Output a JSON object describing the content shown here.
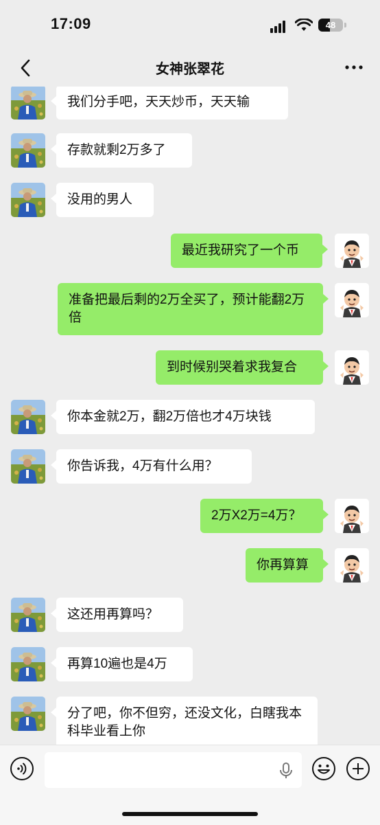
{
  "status": {
    "time": "17:09",
    "battery": "48",
    "battery_level": 0.48
  },
  "header": {
    "title": "女神张翠花"
  },
  "icons": {
    "back": "chevron-left-icon",
    "more": "ellipsis-icon",
    "voice": "voice-icon",
    "mic": "mic-icon",
    "emoji": "emoji-icon",
    "plus": "plus-icon"
  },
  "colors": {
    "background": "#ededed",
    "bubble_sent": "#95ec69",
    "bubble_received": "#ffffff"
  },
  "messages": [
    {
      "side": "left",
      "text": "我们分手吧，天天炒币，天天输"
    },
    {
      "side": "left",
      "text": "存款就剩2万多了"
    },
    {
      "side": "left",
      "text": "没用的男人"
    },
    {
      "side": "right",
      "text": "最近我研究了一个币"
    },
    {
      "side": "right",
      "text": "准备把最后剩的2万全买了，预计能翻2万倍"
    },
    {
      "side": "right",
      "text": "到时候别哭着求我复合"
    },
    {
      "side": "left",
      "text": "你本金就2万，翻2万倍也才4万块钱"
    },
    {
      "side": "left",
      "text": "你告诉我，4万有什么用？"
    },
    {
      "side": "right",
      "text": "2万X2万=4万？"
    },
    {
      "side": "right",
      "text": "你再算算"
    },
    {
      "side": "left",
      "text": "这还用再算吗？"
    },
    {
      "side": "left",
      "text": "再算10遍也是4万"
    },
    {
      "side": "left",
      "text": "分了吧，你不但穷，还没文化，白瞎我本科毕业看上你"
    }
  ],
  "input": {
    "value": "",
    "placeholder": ""
  }
}
